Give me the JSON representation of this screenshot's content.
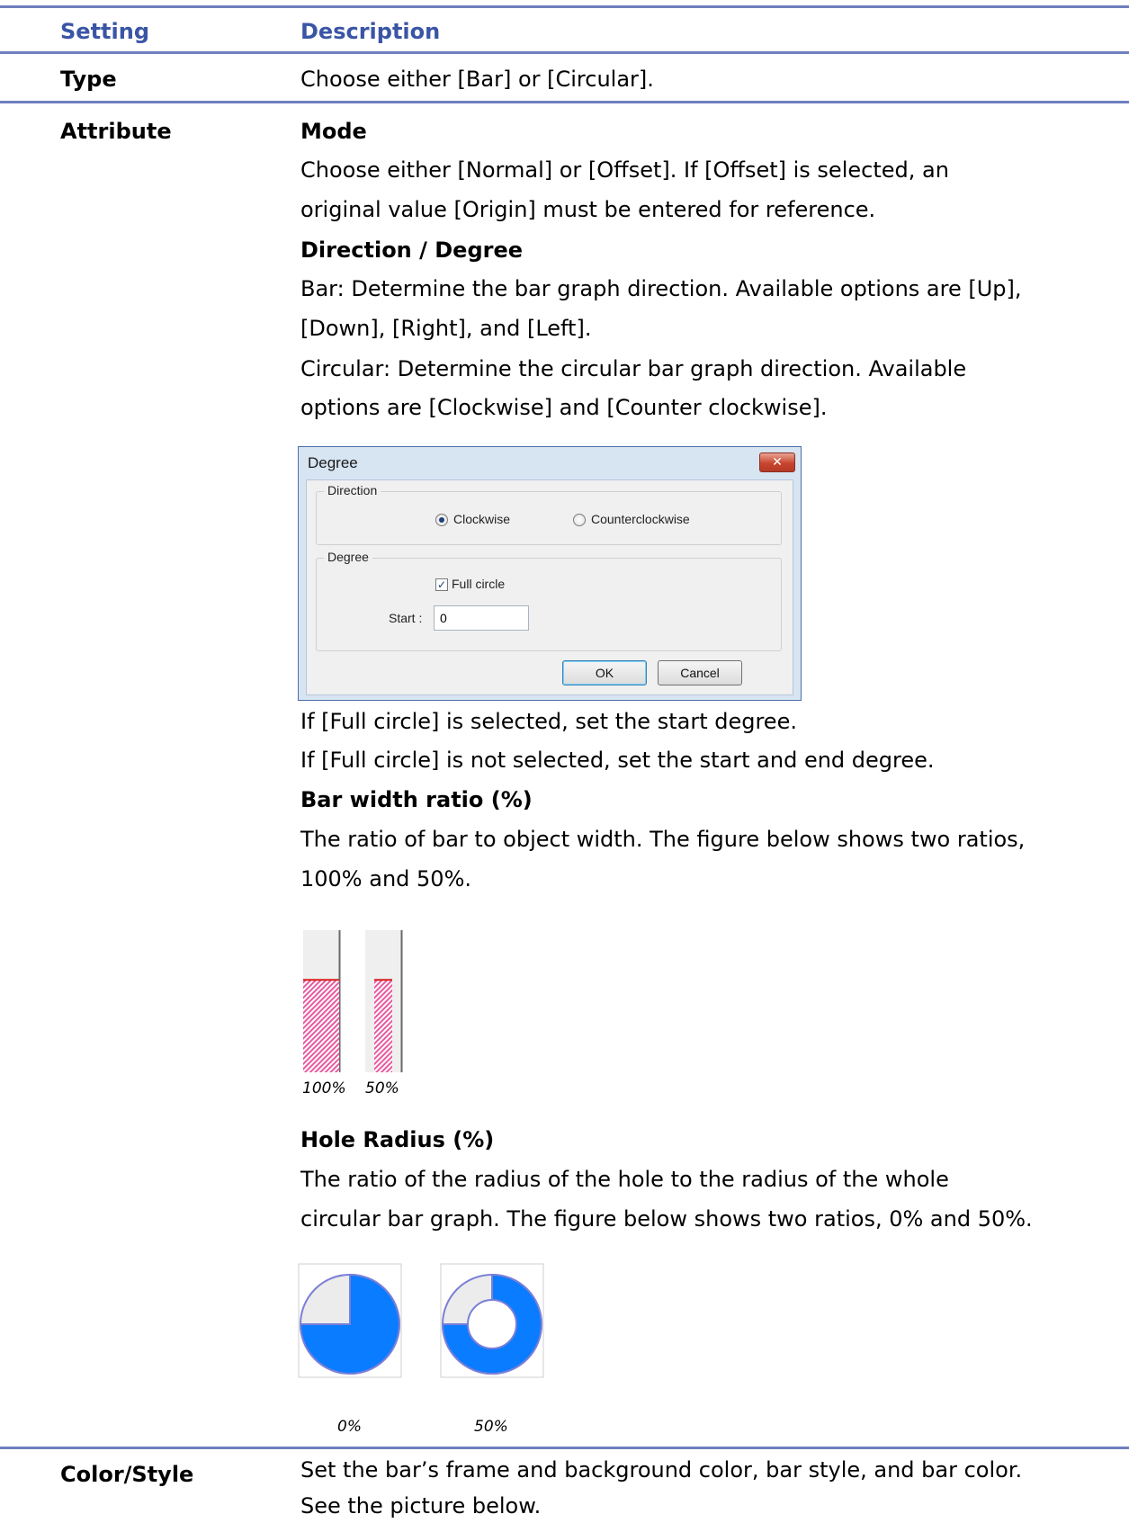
{
  "table": {
    "header": {
      "setting": "Setting",
      "description": "Description"
    },
    "rows": {
      "type": {
        "setting": "Type",
        "description": "Choose either [Bar] or [Circular]."
      },
      "attribute": {
        "setting": "Attribute",
        "mode_heading": "Mode",
        "mode_line1": "Choose either [Normal] or [Offset]. If [Offset] is selected, an",
        "mode_line2": "original value [Origin] must be entered for reference.",
        "direction_heading": "Direction / Degree",
        "direction_line1": "Bar: Determine the bar graph direction. Available options are [Up],",
        "direction_line2": "[Down], [Right], and [Left].",
        "direction_line3": "Circular: Determine the circular bar graph direction. Available",
        "direction_line4": "options are [Clockwise] and [Counter clockwise].",
        "fullcircle_line1": "If [Full circle] is selected, set the start degree.",
        "fullcircle_line2": "If [Full circle] is not selected, set the start and end degree.",
        "barwidth_heading": "Bar width ratio (%)",
        "barwidth_line1": "The ratio of bar to object width. The figure below shows two ratios,",
        "barwidth_line2": "100% and 50%.",
        "hole_heading": "Hole Radius (%)",
        "hole_line1": "The ratio of the radius of the hole to the radius of the whole",
        "hole_line2": "circular bar graph. The figure below shows two ratios, 0% and 50%."
      },
      "color_style": {
        "setting": "Color/Style",
        "line1": "Set the bar’s frame and background color, bar style, and bar color.",
        "line2": "See the picture below."
      }
    }
  },
  "dialog": {
    "title": "Degree",
    "close_icon": "close-x-icon",
    "direction_group": "Direction",
    "clockwise_label": "Clockwise",
    "clockwise_checked": true,
    "counterclockwise_label": "Counterclockwise",
    "counterclockwise_checked": false,
    "degree_group": "Degree",
    "full_circle_label": "Full circle",
    "full_circle_checked": true,
    "start_label": "Start :",
    "start_value": "0",
    "ok_label": "OK",
    "cancel_label": "Cancel"
  },
  "bar_width_figure": {
    "bar_100_caption": "100%",
    "bar_50_caption": "50%",
    "fill_level": 0.65,
    "fill_color": "#e65aa0",
    "level_line_color": "#d81e1e"
  },
  "hole_radius_figure": {
    "hole_0_caption": "0%",
    "hole_50_caption": "50%",
    "fill_fraction": 0.75,
    "fill_color": "#0a7cff",
    "empty_color": "#ececec",
    "outline_color": "#7b7fd6"
  },
  "colors": {
    "header_text": "#3a55a5",
    "rule": "#6f7fbf"
  }
}
